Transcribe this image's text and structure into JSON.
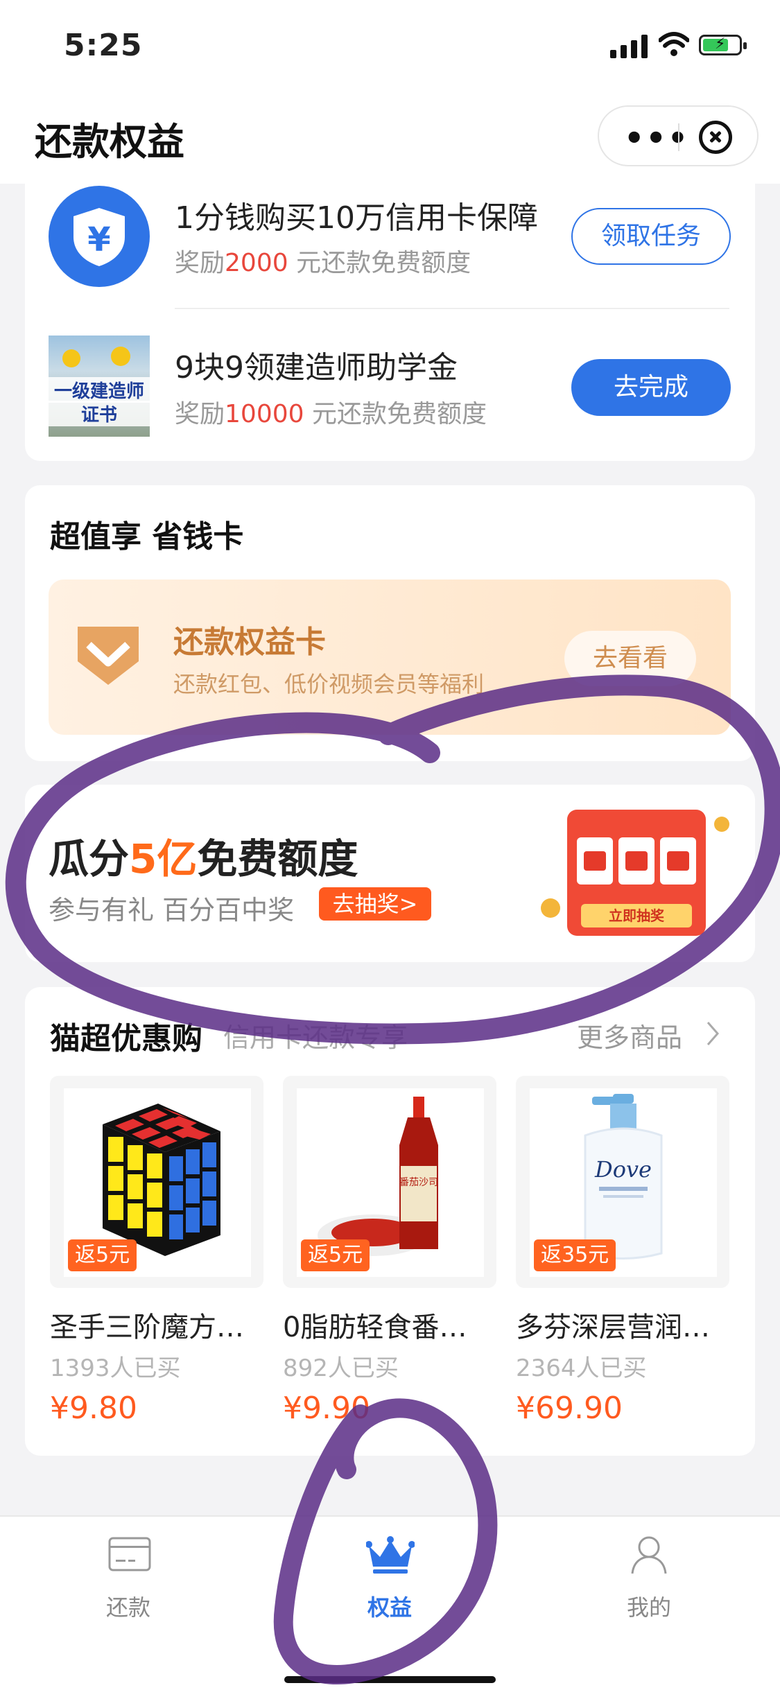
{
  "status_bar": {
    "time": "5:25"
  },
  "header": {
    "title": "还款权益",
    "more_icon": "more-dots-icon",
    "close_icon": "close-circle-icon"
  },
  "tasks": [
    {
      "icon": "yuan-shield-icon",
      "title": "1分钱购买10万信用卡保障",
      "reward_prefix": "奖励",
      "reward_amount": "2000",
      "reward_suffix": " 元还款免费额度",
      "button": "领取任务"
    },
    {
      "icon": "certificate-image",
      "image_text_line1": "一级建造师",
      "image_text_line2": "证书",
      "title": "9块9领建造师助学金",
      "reward_prefix": "奖励",
      "reward_amount": "10000",
      "reward_suffix": " 元还款免费额度",
      "button": "去完成"
    }
  ],
  "savings": {
    "section_title": "超值享 省钱卡",
    "card_title": "还款权益卡",
    "card_subtitle": "还款红包、低价视频会员等福利",
    "button": "去看看"
  },
  "lottery": {
    "title_part1": "瓜分",
    "title_highlight": "5亿",
    "title_part2": "免费额度",
    "subtitle": "参与有礼 百分百中奖",
    "button": "去抽奖>",
    "machine_label": "立即抽奖"
  },
  "shop": {
    "section_title": "猫超优惠购",
    "section_subtitle": "信用卡还款专享",
    "more": "更多商品",
    "products": [
      {
        "image": "rubiks-cube-image",
        "rebate": "返5元",
        "name": "圣手三阶魔方…",
        "sold": "1393人已买",
        "price": "¥9.80"
      },
      {
        "image": "ketchup-bottle-image",
        "rebate": "返5元",
        "name": "0脂肪轻食番…",
        "sold": "892人已买",
        "price": "¥9.90",
        "label_on_bottle": "番茄沙司"
      },
      {
        "image": "dove-cleanser-image",
        "rebate": "返35元",
        "name": "多芬深层营润…",
        "sold": "2364人已买",
        "price": "¥69.90",
        "brand_on_bottle": "Dove"
      }
    ]
  },
  "tabbar": {
    "tabs": [
      {
        "label": "还款",
        "icon": "card-icon",
        "active": false
      },
      {
        "label": "权益",
        "icon": "crown-icon",
        "active": true
      },
      {
        "label": "我的",
        "icon": "user-icon",
        "active": false
      }
    ]
  },
  "colors": {
    "accent": "#2f74e6",
    "reward_red": "#e8473c",
    "orange": "#ff6a1a",
    "scribble": "#5b2d86"
  }
}
